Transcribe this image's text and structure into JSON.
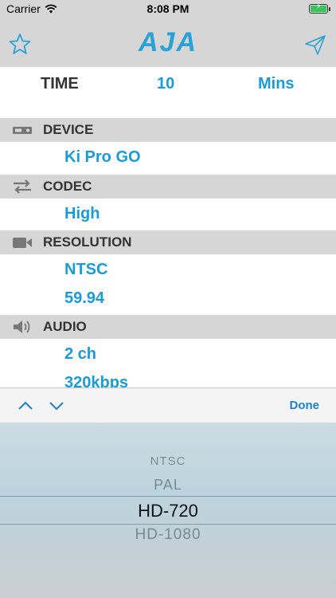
{
  "status": {
    "carrier": "Carrier",
    "time": "8:08 PM"
  },
  "nav": {
    "logo": "AJA"
  },
  "time_row": {
    "label": "TIME",
    "value": "10",
    "unit": "Mins"
  },
  "sections": {
    "device": {
      "title": "DEVICE",
      "values": [
        "Ki Pro GO"
      ]
    },
    "codec": {
      "title": "CODEC",
      "values": [
        "High"
      ]
    },
    "resolution": {
      "title": "RESOLUTION",
      "values": [
        "NTSC",
        "59.94"
      ]
    },
    "audio": {
      "title": "AUDIO",
      "values": [
        "2 ch",
        "320kbps"
      ]
    }
  },
  "toolbar": {
    "done_label": "Done"
  },
  "picker": {
    "options": [
      "NTSC",
      "PAL",
      "HD-720",
      "HD-1080"
    ],
    "selected": "HD-720"
  },
  "colors": {
    "accent": "#1a9bd7",
    "header_bg": "#d6d6d6",
    "done": "#1a7fd7"
  }
}
